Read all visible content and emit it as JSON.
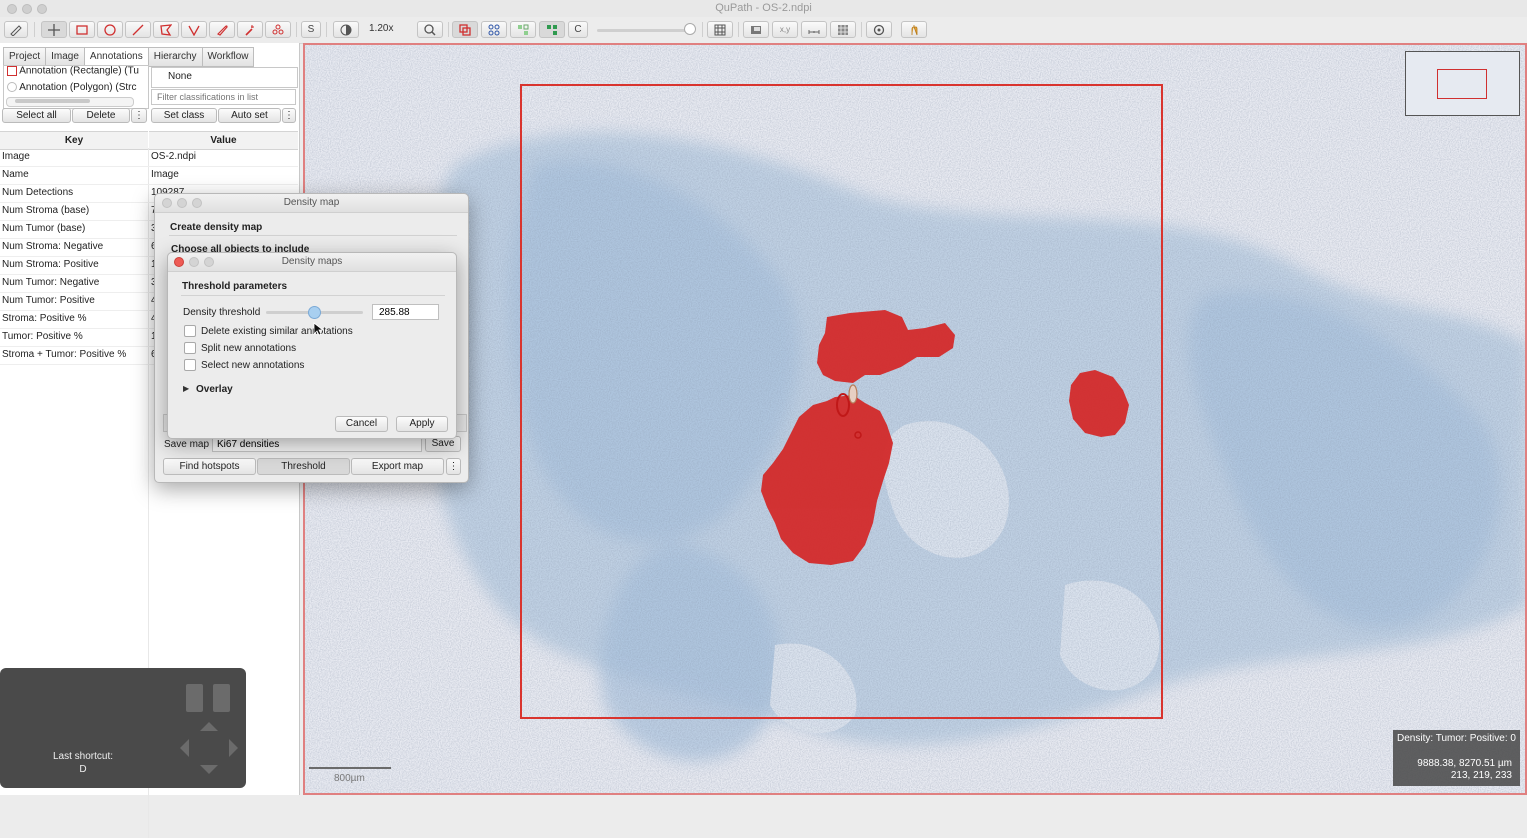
{
  "window": {
    "title": "QuPath - OS-2.ndpi"
  },
  "toolbar": {
    "zoom": "1.20x",
    "s_label": "S",
    "c_label": "C"
  },
  "left_panel": {
    "tabs": [
      "Project",
      "Image",
      "Annotations",
      "Hierarchy",
      "Workflow"
    ],
    "annotation_list": [
      "Annotation (Rectangle) (Tu",
      "Annotation (Polygon) (Strc"
    ],
    "class_selected": "None",
    "filter_placeholder": "Filter classifications in list",
    "buttons": {
      "select_all": "Select all",
      "delete": "Delete",
      "set_class": "Set class",
      "auto_set": "Auto set",
      "more": "⋮"
    },
    "table_headers": {
      "key": "Key",
      "value": "Value"
    },
    "rows": [
      {
        "key": "Image",
        "value": "OS-2.ndpi"
      },
      {
        "key": "Name",
        "value": "Image"
      },
      {
        "key": "Num Detections",
        "value": "109287"
      },
      {
        "key": "Num Stroma (base)",
        "value": "7"
      },
      {
        "key": "Num Tumor (base)",
        "value": "3"
      },
      {
        "key": "Num Stroma: Negative",
        "value": "6"
      },
      {
        "key": "Num Stroma: Positive",
        "value": "1"
      },
      {
        "key": "Num Tumor: Negative",
        "value": "3"
      },
      {
        "key": "Num Tumor: Positive",
        "value": "4"
      },
      {
        "key": "Stroma: Positive %",
        "value": "4"
      },
      {
        "key": "Tumor: Positive %",
        "value": "1"
      },
      {
        "key": "Stroma + Tumor: Positive %",
        "value": "6"
      }
    ]
  },
  "shortcut": {
    "label": "Last shortcut:",
    "key": "D"
  },
  "density_map_dialog": {
    "title": "Density map",
    "heading": "Create density map",
    "subheading": "Choose all objects to include",
    "save_label": "Save map",
    "save_name": "Ki67 densities",
    "save_button": "Save",
    "find_hotspots": "Find hotspots",
    "threshold": "Threshold",
    "export_map": "Export map",
    "more": "⋮"
  },
  "density_maps_dialog": {
    "title": "Density maps",
    "section": "Threshold parameters",
    "threshold_label": "Density threshold",
    "threshold_value": "285.88",
    "slider_fraction": 0.5,
    "options": [
      "Delete existing similar annotations",
      "Split new annotations",
      "Select new annotations"
    ],
    "overlay": "Overlay",
    "cancel": "Cancel",
    "apply": "Apply"
  },
  "viewer": {
    "status_line1": "Density: Tumor: Positive: 0",
    "status_line2": "9888.38, 8270.51 µm",
    "status_line3": "213, 219, 233",
    "scale_label": "800µm"
  },
  "colors": {
    "annotation_red": "#d32a2a",
    "tissue_blue": "#b8cde3",
    "background": "#e9ebf2"
  }
}
